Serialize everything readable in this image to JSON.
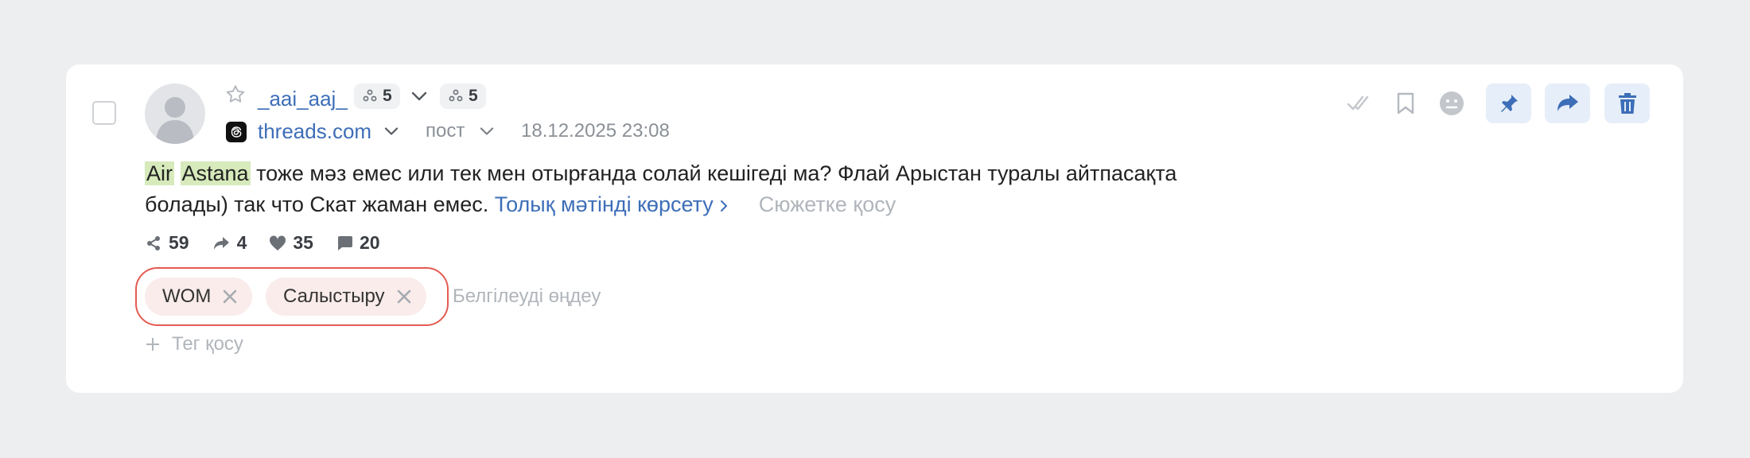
{
  "post": {
    "author": "_aai_aaj_",
    "badge_count_1": "5",
    "badge_count_2": "5",
    "source": "threads.com",
    "type": "пост",
    "date": "18.12.2025 23:08",
    "text": {
      "highlight_1": "Air",
      "highlight_2": "Astana",
      "body_line1": " тоже мәз емес или тек мен отырғанда солай кешігеді ма? Флай Арыстан туралы айтпасақта",
      "body_line2": "болады) так что Скат жаман емес.",
      "show_full": "Толық мәтінді көрсету",
      "add_to_story": "Сюжетке қосу"
    },
    "stats": {
      "shares": "59",
      "reposts": "4",
      "likes": "35",
      "comments": "20"
    },
    "tags": [
      "WOM",
      "Салыстыру"
    ],
    "edit_tags": "Белгілеуді өңдеу",
    "add_tag": "Тег қосу"
  },
  "icons": {
    "star": "star-outline-icon",
    "audience": "audience-icon",
    "chevron": "chevron-down-icon",
    "threads": "threads-logo-icon",
    "check": "check-icon",
    "bookmark": "bookmark-icon",
    "sentiment": "neutral-face-icon",
    "pin": "pin-icon",
    "forward": "forward-icon",
    "trash": "trash-icon"
  },
  "colors": {
    "accent": "#3d6eb8",
    "highlight": "#d6eabb",
    "tag_bg": "#f9ecea",
    "tag_box_border": "#e45b52",
    "action_bg": "#e6eef9"
  }
}
